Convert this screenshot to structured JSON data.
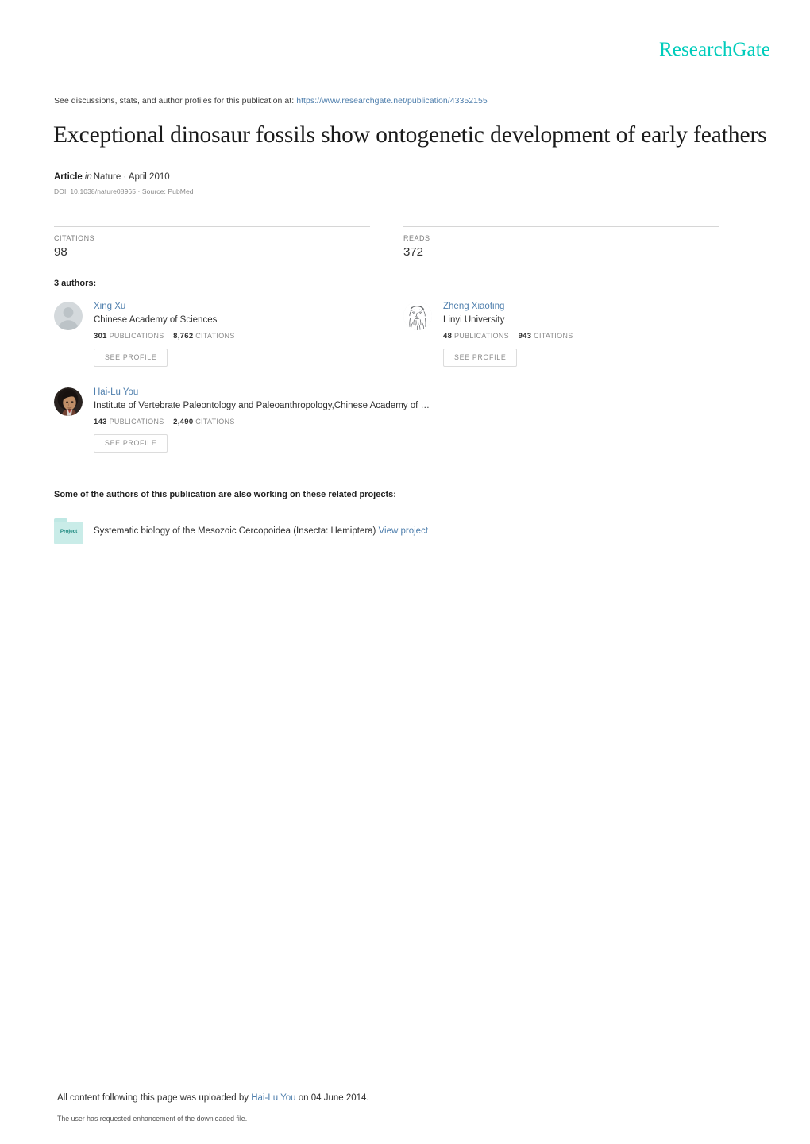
{
  "brand": {
    "name": "ResearchGate",
    "color": "#00ccbb"
  },
  "header": {
    "discuss_prefix": "See discussions, stats, and author profiles for this publication at:",
    "discuss_url": "https://www.researchgate.net/publication/43352155"
  },
  "publication": {
    "title": "Exceptional dinosaur fossils show ontogenetic development of early feathers",
    "kind": "Article",
    "in_word": "in",
    "venue": "Nature · April 2010",
    "doi_line": "DOI: 10.1038/nature08965 · Source: PubMed"
  },
  "stats": [
    {
      "label": "CITATIONS",
      "value": "98"
    },
    {
      "label": "READS",
      "value": "372"
    }
  ],
  "authors_heading": "3 authors:",
  "authors": [
    {
      "name": "Xing Xu",
      "affiliation": "Chinese Academy of Sciences",
      "publications": "301",
      "publications_label": "PUBLICATIONS",
      "citations": "8,762",
      "citations_label": "CITATIONS",
      "button": "SEE PROFILE",
      "avatar_kind": "silhouette-avatar"
    },
    {
      "name": "Zheng Xiaoting",
      "affiliation": "Linyi University",
      "publications": "48",
      "publications_label": "PUBLICATIONS",
      "citations": "943",
      "citations_label": "CITATIONS",
      "button": "SEE PROFILE",
      "avatar_kind": "sketch-portrait-avatar"
    },
    {
      "name": "Hai-Lu You",
      "affiliation": "Institute of Vertebrate Paleontology and Paleoanthropology,Chinese Academy of …",
      "publications": "143",
      "publications_label": "PUBLICATIONS",
      "citations": "2,490",
      "citations_label": "CITATIONS",
      "button": "SEE PROFILE",
      "avatar_kind": "photo-avatar"
    }
  ],
  "projects": {
    "heading": "Some of the authors of this publication are also working on these related projects:",
    "items": [
      {
        "icon_label": "Project",
        "title": "Systematic biology of the Mesozoic Cercopoidea (Insecta: Hemiptera)",
        "link": "View project"
      }
    ]
  },
  "footer": {
    "upload_prefix": "All content following this page was uploaded by",
    "upload_user": "Hai-Lu You",
    "upload_suffix": "on 04 June 2014.",
    "note": "The user has requested enhancement of the downloaded file."
  }
}
